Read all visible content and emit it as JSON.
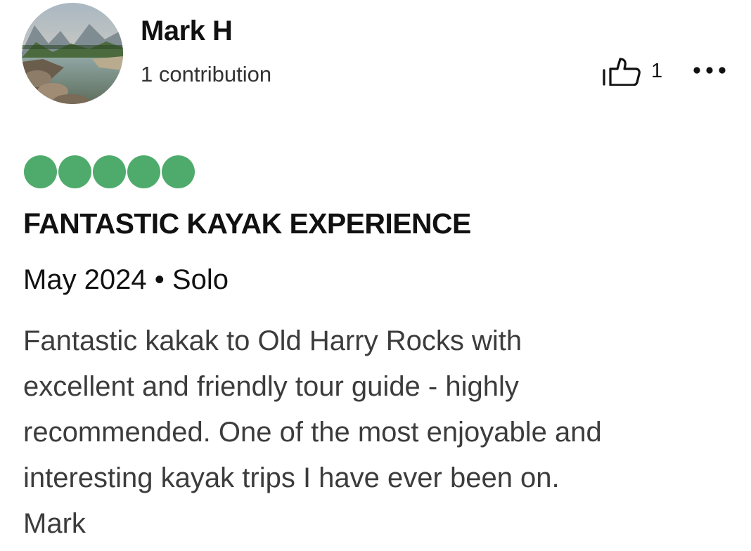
{
  "reviewer": {
    "name": "Mark H",
    "contributions": "1 contribution",
    "avatar_icon": "landscape-river-avatar"
  },
  "actions": {
    "helpful_icon": "thumbs-up-icon",
    "helpful_count": "1",
    "more_icon": "more-options-icon"
  },
  "rating": {
    "value": 5,
    "max": 5,
    "color": "#4fab6c"
  },
  "review": {
    "title": "FANTASTIC KAYAK EXPERIENCE",
    "trip_meta": "May 2024 • Solo",
    "body_lines": [
      "Fantastic kakak to Old Harry Rocks with",
      "excellent and friendly tour guide - highly",
      "recommended. One of the most enjoyable and",
      "interesting kayak trips I have ever been on.",
      "Mark"
    ]
  }
}
